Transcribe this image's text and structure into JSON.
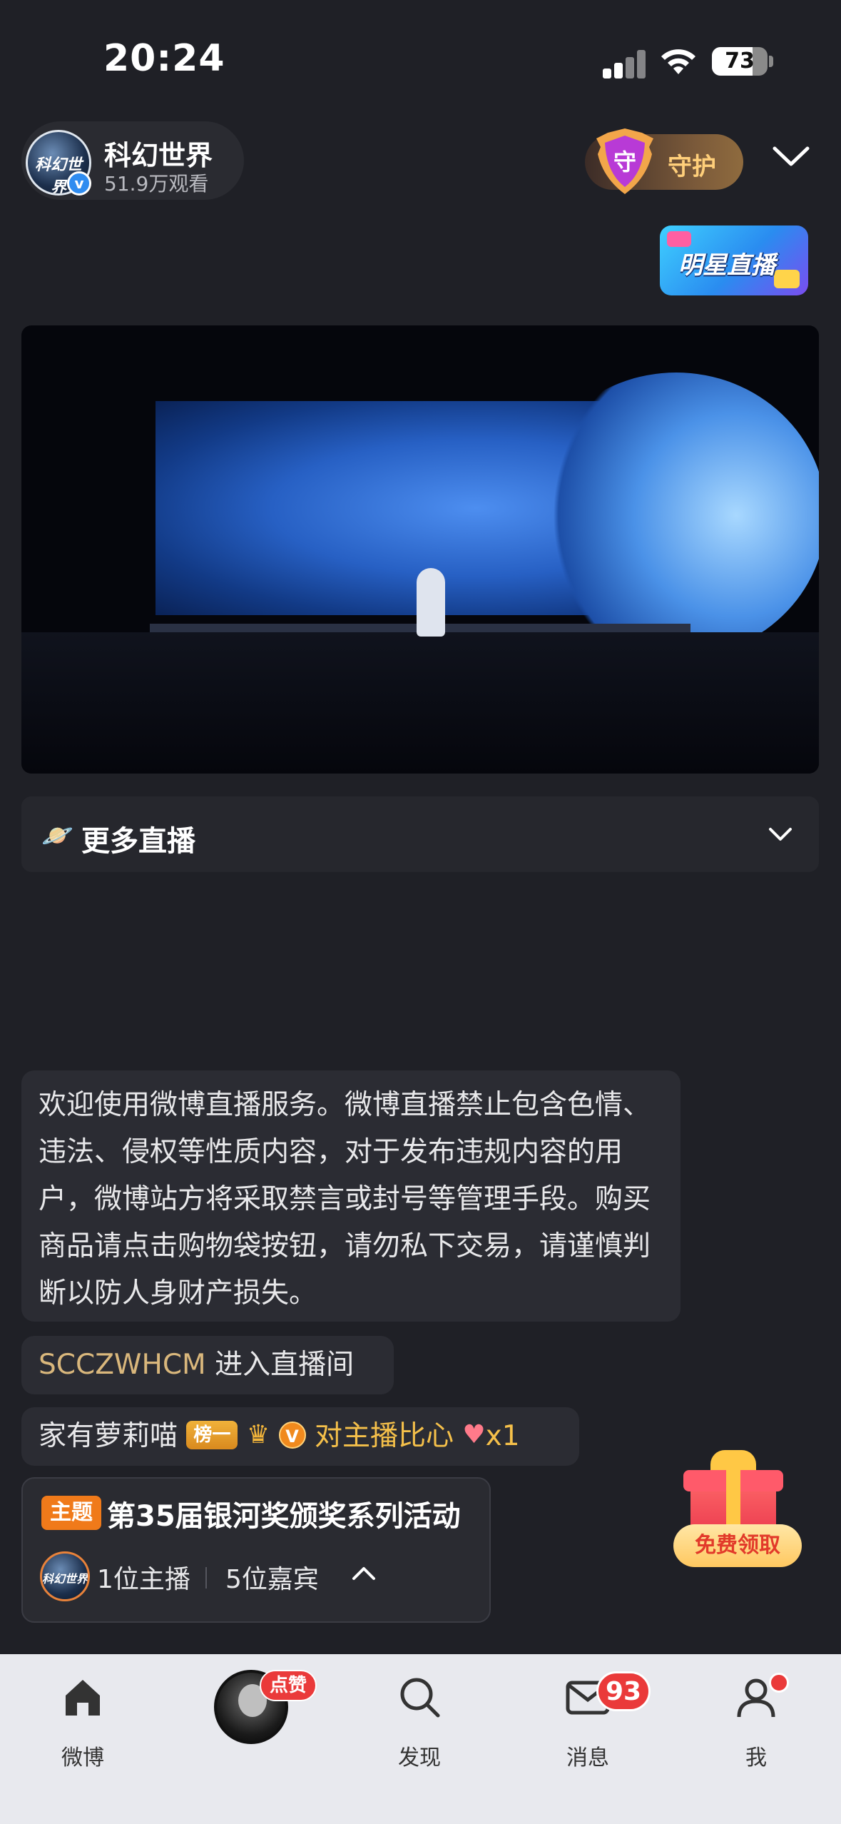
{
  "status_bar": {
    "time": "20:24",
    "battery": "73",
    "battery_level": 0.73
  },
  "host": {
    "avatar_text": "科幻世界",
    "name": "科幻世界",
    "views": "51.9万观看",
    "verified_mark": "v"
  },
  "header": {
    "guard_label": "守护",
    "guard_icon_char": "守",
    "star_live_label": "明星直播"
  },
  "more_live": {
    "icon": "🪐",
    "label": "更多直播"
  },
  "chat": {
    "notice": "欢迎使用微博直播服务。微博直播禁止包含色情、违法、侵权等性质内容，对于发布违规内容的用户，微博站方将采取禁言或封号等管理手段。购买商品请点击购物袋按钮，请勿私下交易，请谨慎判断以防人身财产损失。",
    "enter": {
      "user": "SCCZWHCM",
      "action": "进入直播间"
    },
    "gift": {
      "user": "家有萝莉喵",
      "rank": "榜一",
      "vip": "V",
      "action": "对主播比心",
      "count": "x1"
    }
  },
  "theme": {
    "tag": "主题",
    "title": "第35届银河奖颁奖系列活动",
    "avatar_text": "科幻世界",
    "hosts": "1位主播",
    "guests": "5位嘉宾"
  },
  "free_gift": {
    "label": "免费领取"
  },
  "tabbar": {
    "home": "微博",
    "like_badge": "点赞",
    "discover": "发现",
    "messages": "消息",
    "messages_badge": "93",
    "me": "我"
  },
  "colors": {
    "background": "#1f2026",
    "accent_orange": "#f07a1a",
    "gold": "#d9b77c",
    "badge_red": "#ea3a3a"
  }
}
